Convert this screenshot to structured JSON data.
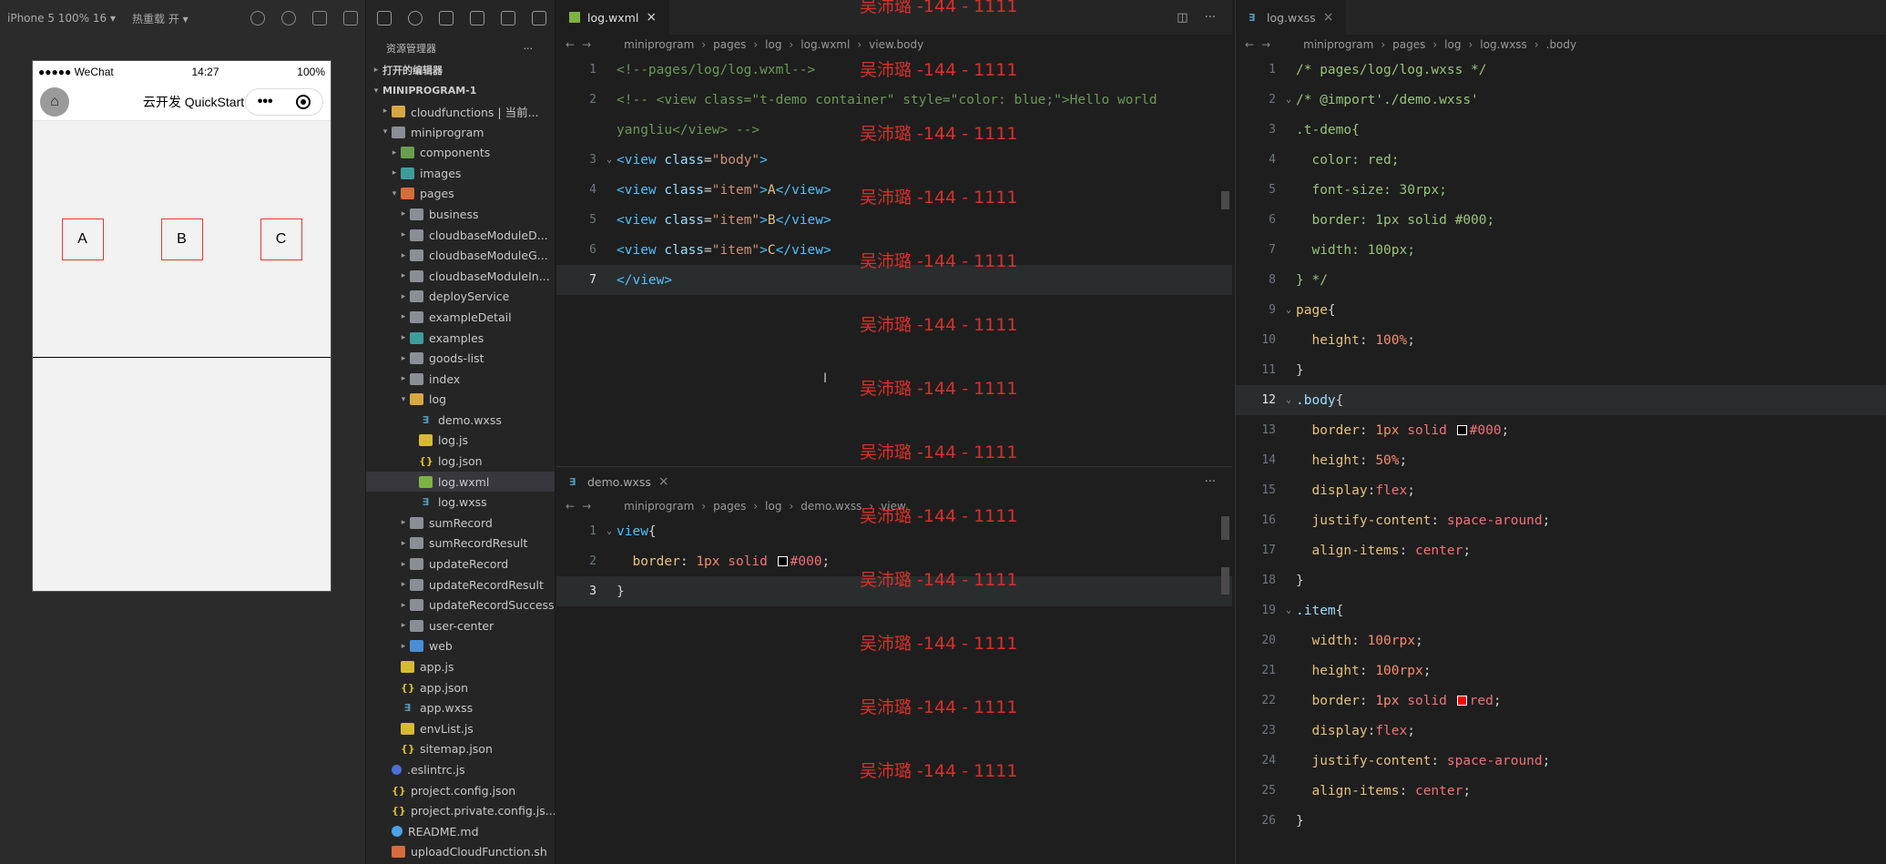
{
  "simulator": {
    "device": "iPhone 5 100% 16 ▾",
    "hot_reload": "热重载 开 ▾",
    "status": {
      "carrier": "●●●●● WeChat",
      "time": "14:27",
      "battery": "100%"
    },
    "nav_title": "云开发 QuickStart",
    "items": [
      "A",
      "B",
      "C"
    ]
  },
  "explorer": {
    "title": "资源管理器",
    "open_editors": "打开的编辑器",
    "project": "MINIPROGRAM-1",
    "tree": [
      {
        "label": "cloudfunctions | 当前...",
        "indent": 1,
        "icon": "folder-y",
        "tw": "▸"
      },
      {
        "label": "miniprogram",
        "indent": 1,
        "icon": "folder",
        "tw": "▾"
      },
      {
        "label": "components",
        "indent": 2,
        "icon": "folder-g",
        "tw": "▸"
      },
      {
        "label": "images",
        "indent": 2,
        "icon": "folder-t",
        "tw": "▸"
      },
      {
        "label": "pages",
        "indent": 2,
        "icon": "folder-o",
        "tw": "▾"
      },
      {
        "label": "business",
        "indent": 3,
        "icon": "folder",
        "tw": "▸"
      },
      {
        "label": "cloudbaseModuleD...",
        "indent": 3,
        "icon": "folder",
        "tw": "▸"
      },
      {
        "label": "cloudbaseModuleG...",
        "indent": 3,
        "icon": "folder",
        "tw": "▸"
      },
      {
        "label": "cloudbaseModuleIn...",
        "indent": 3,
        "icon": "folder",
        "tw": "▸"
      },
      {
        "label": "deployService",
        "indent": 3,
        "icon": "folder",
        "tw": "▸"
      },
      {
        "label": "exampleDetail",
        "indent": 3,
        "icon": "folder",
        "tw": "▸"
      },
      {
        "label": "examples",
        "indent": 3,
        "icon": "folder-t",
        "tw": "▸"
      },
      {
        "label": "goods-list",
        "indent": 3,
        "icon": "folder",
        "tw": "▸"
      },
      {
        "label": "index",
        "indent": 3,
        "icon": "folder",
        "tw": "▸"
      },
      {
        "label": "log",
        "indent": 3,
        "icon": "folder-y",
        "tw": "▾"
      },
      {
        "label": "demo.wxss",
        "indent": 4,
        "icon": "wxss",
        "tw": ""
      },
      {
        "label": "log.js",
        "indent": 4,
        "icon": "js",
        "tw": ""
      },
      {
        "label": "log.json",
        "indent": 4,
        "icon": "json",
        "tw": ""
      },
      {
        "label": "log.wxml",
        "indent": 4,
        "icon": "wxml",
        "tw": "",
        "selected": true
      },
      {
        "label": "log.wxss",
        "indent": 4,
        "icon": "wxss",
        "tw": ""
      },
      {
        "label": "sumRecord",
        "indent": 3,
        "icon": "folder",
        "tw": "▸"
      },
      {
        "label": "sumRecordResult",
        "indent": 3,
        "icon": "folder",
        "tw": "▸"
      },
      {
        "label": "updateRecord",
        "indent": 3,
        "icon": "folder",
        "tw": "▸"
      },
      {
        "label": "updateRecordResult",
        "indent": 3,
        "icon": "folder",
        "tw": "▸"
      },
      {
        "label": "updateRecordSuccess",
        "indent": 3,
        "icon": "folder",
        "tw": "▸"
      },
      {
        "label": "user-center",
        "indent": 3,
        "icon": "folder",
        "tw": "▸"
      },
      {
        "label": "web",
        "indent": 3,
        "icon": "folder-b",
        "tw": "▸"
      },
      {
        "label": "app.js",
        "indent": 2,
        "icon": "js",
        "tw": ""
      },
      {
        "label": "app.json",
        "indent": 2,
        "icon": "json",
        "tw": ""
      },
      {
        "label": "app.wxss",
        "indent": 2,
        "icon": "wxss",
        "tw": ""
      },
      {
        "label": "envList.js",
        "indent": 2,
        "icon": "js",
        "tw": ""
      },
      {
        "label": "sitemap.json",
        "indent": 2,
        "icon": "json",
        "tw": ""
      },
      {
        "label": ".eslintrc.js",
        "indent": 1,
        "icon": "dot",
        "tw": ""
      },
      {
        "label": "project.config.json",
        "indent": 1,
        "icon": "json",
        "tw": ""
      },
      {
        "label": "project.private.config.js...",
        "indent": 1,
        "icon": "json",
        "tw": ""
      },
      {
        "label": "README.md",
        "indent": 1,
        "icon": "info",
        "tw": ""
      },
      {
        "label": "uploadCloudFunction.sh",
        "indent": 1,
        "icon": "sh",
        "tw": ""
      }
    ]
  },
  "editor1": {
    "tab": "log.wxml",
    "crumbs": [
      "miniprogram",
      "pages",
      "log",
      "log.wxml",
      "view.body"
    ],
    "lines": [
      [
        [
          "c-com",
          "<!--pages/log/log.wxml-->"
        ]
      ],
      [
        [
          "c-com",
          "<!-- <view class=\"t-demo container\" style=\"color: blue;\">Hello world"
        ]
      ],
      [
        [
          "c-com",
          "yangliu</view> -->"
        ]
      ],
      [
        [
          "c-tag",
          "<view "
        ],
        [
          "c-attr",
          "class"
        ],
        [
          "c-punc",
          "="
        ],
        [
          "c-str",
          "\"body\""
        ],
        [
          "c-tag",
          ">"
        ]
      ],
      [
        [
          "c-tag",
          "<view "
        ],
        [
          "c-attr",
          "class"
        ],
        [
          "c-punc",
          "="
        ],
        [
          "c-str",
          "\"item\""
        ],
        [
          "c-tag",
          ">"
        ],
        [
          "c-txt",
          "A"
        ],
        [
          "c-tag",
          "</view>"
        ]
      ],
      [
        [
          "c-tag",
          "<view "
        ],
        [
          "c-attr",
          "class"
        ],
        [
          "c-punc",
          "="
        ],
        [
          "c-str",
          "\"item\""
        ],
        [
          "c-tag",
          ">"
        ],
        [
          "c-txt",
          "B"
        ],
        [
          "c-tag",
          "</view>"
        ]
      ],
      [
        [
          "c-tag",
          "<view "
        ],
        [
          "c-attr",
          "class"
        ],
        [
          "c-punc",
          "="
        ],
        [
          "c-str",
          "\"item\""
        ],
        [
          "c-tag",
          ">"
        ],
        [
          "c-txt",
          "C"
        ],
        [
          "c-tag",
          "</view>"
        ]
      ],
      [
        [
          "c-tag",
          "</view>"
        ]
      ]
    ],
    "line_numbers": [
      "1",
      "2",
      "",
      "3",
      "4",
      "5",
      "6",
      "7"
    ]
  },
  "editor2": {
    "tab": "demo.wxss",
    "crumbs": [
      "miniprogram",
      "pages",
      "log",
      "demo.wxss",
      "view"
    ],
    "lines": [
      [
        [
          "c-tag",
          "view"
        ],
        [
          "c-punc",
          "{"
        ]
      ],
      [
        [
          "c-prop",
          "  border"
        ],
        [
          "c-punc",
          ": "
        ],
        [
          "c-num",
          "1px "
        ],
        [
          "c-val",
          "solid "
        ],
        [
          "swatch",
          "#000000"
        ],
        [
          "c-val",
          "#000"
        ],
        [
          "c-punc",
          ";"
        ]
      ],
      [
        [
          "c-punc",
          "}"
        ]
      ]
    ],
    "line_numbers": [
      "1",
      "2",
      "3"
    ]
  },
  "editor3": {
    "tab": "log.wxss",
    "crumbs": [
      "miniprogram",
      "pages",
      "log",
      "log.wxss",
      ".body"
    ],
    "lines": [
      [
        [
          "c-green",
          "/* pages/log/log.wxss */"
        ]
      ],
      [
        [
          "c-green",
          "/* @import'./demo.wxss'"
        ]
      ],
      [
        [
          "c-green",
          ".t-demo{"
        ]
      ],
      [
        [
          "c-green",
          "  color: red;"
        ]
      ],
      [
        [
          "c-green",
          "  font-size: 30rpx;"
        ]
      ],
      [
        [
          "c-green",
          "  border: 1px solid #000;"
        ]
      ],
      [
        [
          "c-green",
          "  width: 100px;"
        ]
      ],
      [
        [
          "c-green",
          "} */"
        ]
      ],
      [
        [
          "c-sel",
          "page"
        ],
        [
          "c-punc",
          "{"
        ]
      ],
      [
        [
          "c-prop",
          "  height"
        ],
        [
          "c-punc",
          ": "
        ],
        [
          "c-num",
          "100%"
        ],
        [
          "c-punc",
          ";"
        ]
      ],
      [
        [
          "c-punc",
          "}"
        ]
      ],
      [
        [
          "c-attr",
          ".body"
        ],
        [
          "c-punc",
          "{"
        ]
      ],
      [
        [
          "c-prop",
          "  border"
        ],
        [
          "c-punc",
          ": "
        ],
        [
          "c-num",
          "1px "
        ],
        [
          "c-val",
          "solid "
        ],
        [
          "swatch",
          "#000000"
        ],
        [
          "c-val",
          "#000"
        ],
        [
          "c-punc",
          ";"
        ]
      ],
      [
        [
          "c-prop",
          "  height"
        ],
        [
          "c-punc",
          ": "
        ],
        [
          "c-num",
          "50%"
        ],
        [
          "c-punc",
          ";"
        ]
      ],
      [
        [
          "c-prop",
          "  display"
        ],
        [
          "c-punc",
          ":"
        ],
        [
          "c-val",
          "flex"
        ],
        [
          "c-punc",
          ";"
        ]
      ],
      [
        [
          "c-prop",
          "  justify-content"
        ],
        [
          "c-punc",
          ": "
        ],
        [
          "c-val",
          "space-around"
        ],
        [
          "c-punc",
          ";"
        ]
      ],
      [
        [
          "c-prop",
          "  align-items"
        ],
        [
          "c-punc",
          ": "
        ],
        [
          "c-val",
          "center"
        ],
        [
          "c-punc",
          ";"
        ]
      ],
      [
        [
          "c-punc",
          "}"
        ]
      ],
      [
        [
          "c-attr",
          ".item"
        ],
        [
          "c-punc",
          "{"
        ]
      ],
      [
        [
          "c-prop",
          "  width"
        ],
        [
          "c-punc",
          ": "
        ],
        [
          "c-num",
          "100rpx"
        ],
        [
          "c-punc",
          ";"
        ]
      ],
      [
        [
          "c-prop",
          "  height"
        ],
        [
          "c-punc",
          ": "
        ],
        [
          "c-num",
          "100rpx"
        ],
        [
          "c-punc",
          ";"
        ]
      ],
      [
        [
          "c-prop",
          "  border"
        ],
        [
          "c-punc",
          ": "
        ],
        [
          "c-num",
          "1px "
        ],
        [
          "c-val",
          "solid "
        ],
        [
          "swatch",
          "#ff0000"
        ],
        [
          "c-val",
          "red"
        ],
        [
          "c-punc",
          ";"
        ]
      ],
      [
        [
          "c-prop",
          "  display"
        ],
        [
          "c-punc",
          ":"
        ],
        [
          "c-val",
          "flex"
        ],
        [
          "c-punc",
          ";"
        ]
      ],
      [
        [
          "c-prop",
          "  justify-content"
        ],
        [
          "c-punc",
          ": "
        ],
        [
          "c-val",
          "space-around"
        ],
        [
          "c-punc",
          ";"
        ]
      ],
      [
        [
          "c-prop",
          "  align-items"
        ],
        [
          "c-punc",
          ": "
        ],
        [
          "c-val",
          "center"
        ],
        [
          "c-punc",
          ";"
        ]
      ],
      [
        [
          "c-punc",
          "}"
        ]
      ]
    ]
  },
  "watermark": {
    "text": "吴沛璐 -144 - 1111",
    "count": 13
  }
}
